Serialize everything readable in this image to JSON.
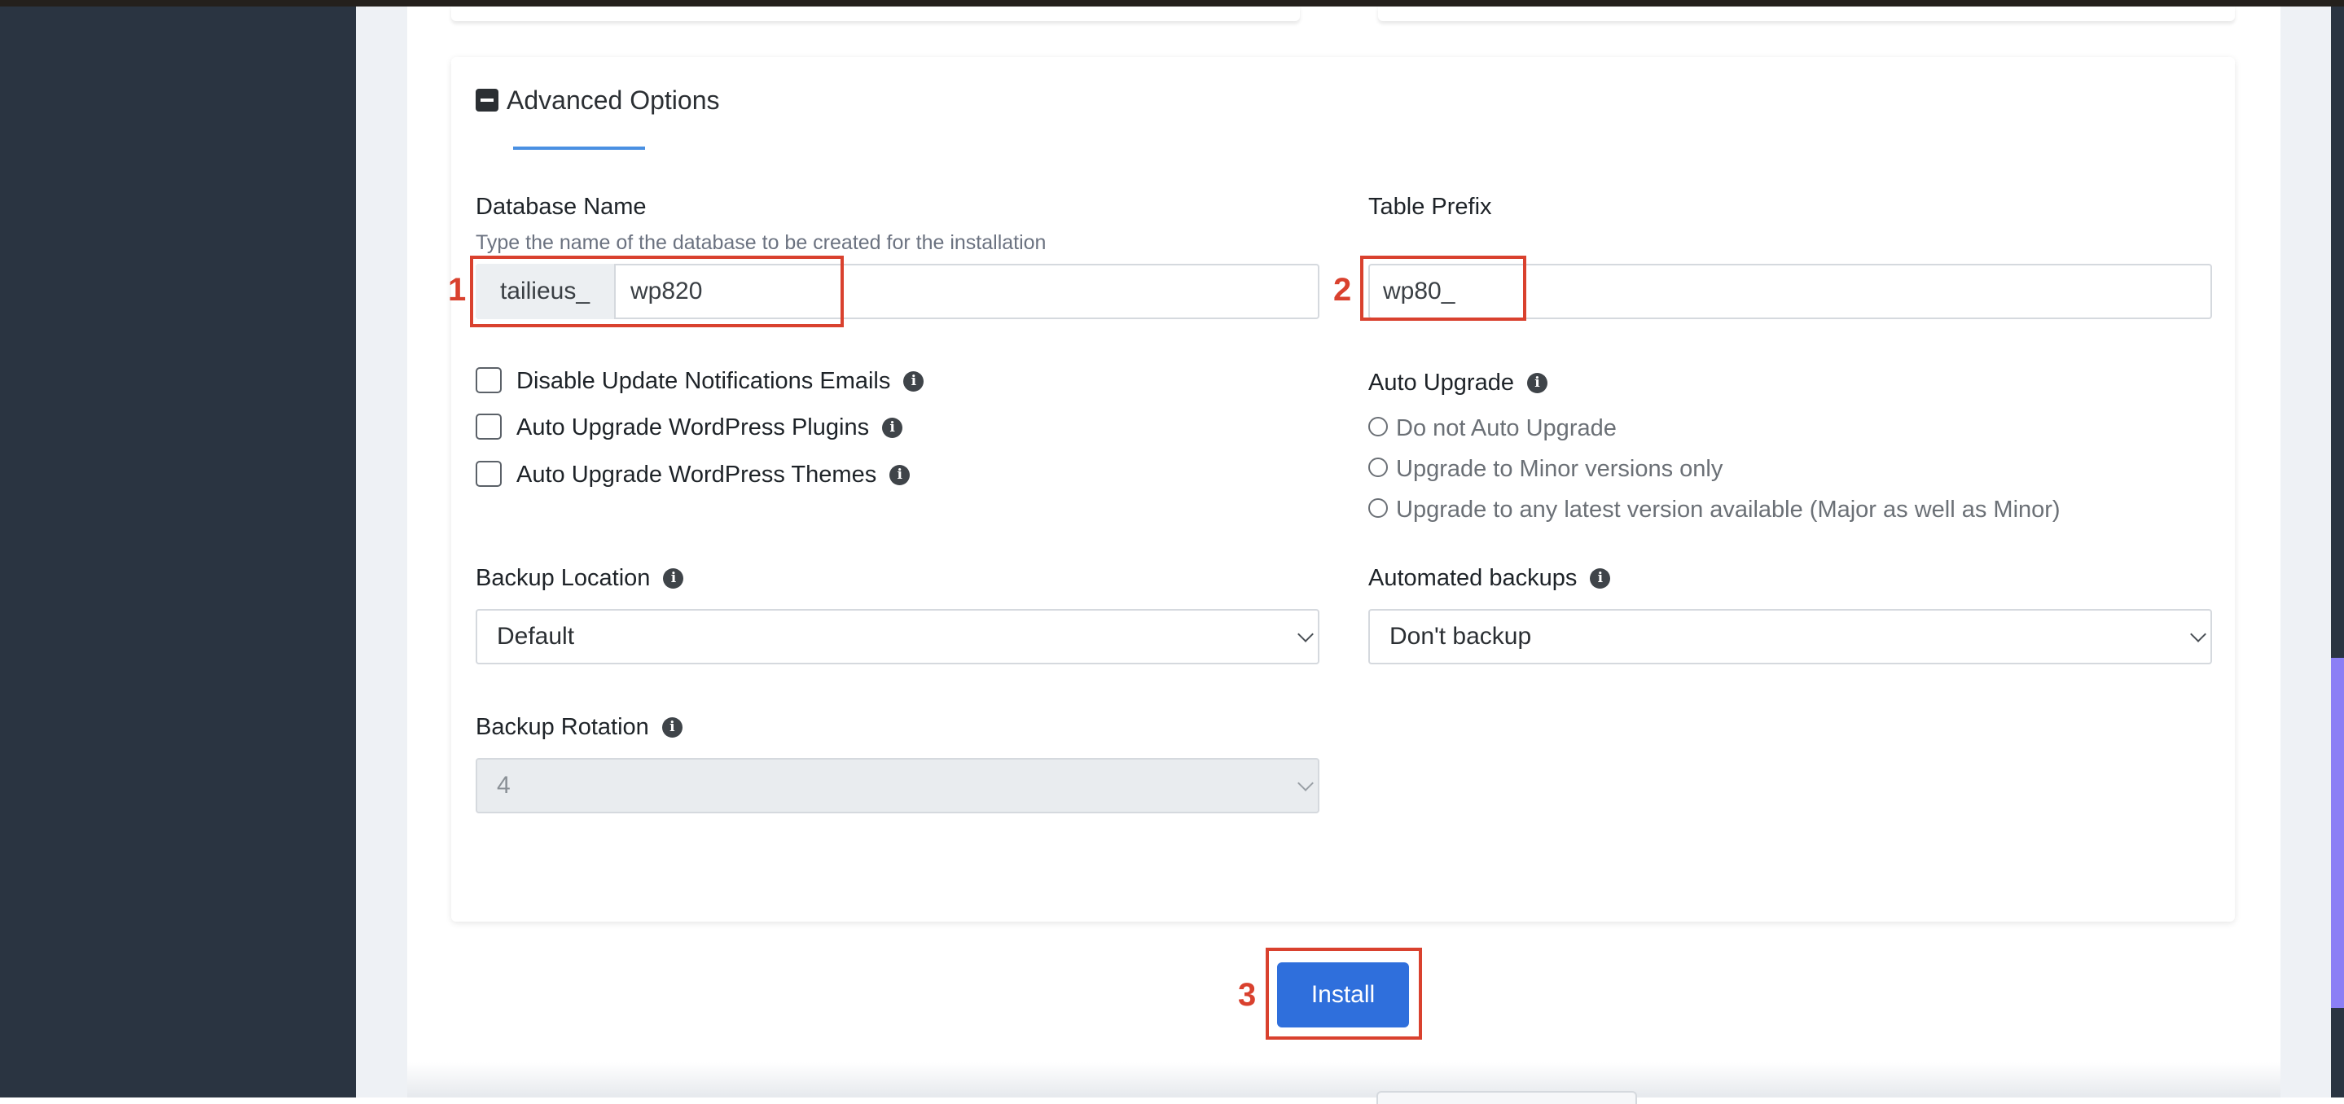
{
  "advanced_options": {
    "title": "Advanced Options",
    "database_name": {
      "label": "Database Name",
      "help": "Type the name of the database to be created for the installation",
      "prefix": "tailieus_",
      "value": "wp820"
    },
    "table_prefix": {
      "label": "Table Prefix",
      "value": "wp80_"
    },
    "checkboxes": [
      {
        "label": "Disable Update Notifications Emails",
        "checked": false
      },
      {
        "label": "Auto Upgrade WordPress Plugins",
        "checked": false
      },
      {
        "label": "Auto Upgrade WordPress Themes",
        "checked": false
      }
    ],
    "auto_upgrade": {
      "label": "Auto Upgrade",
      "options": [
        "Do not Auto Upgrade",
        "Upgrade to Minor versions only",
        "Upgrade to any latest version available (Major as well as Minor)"
      ]
    },
    "backup_location": {
      "label": "Backup Location",
      "selected": "Default"
    },
    "automated_backups": {
      "label": "Automated backups",
      "selected": "Don't backup"
    },
    "backup_rotation": {
      "label": "Backup Rotation",
      "selected": "4"
    }
  },
  "install_button": {
    "label": "Install"
  },
  "annotations": [
    "1",
    "2",
    "3"
  ],
  "icons": {
    "info": "info-icon",
    "collapse": "minus-square-icon",
    "select": "chevron-down-icon"
  },
  "colors": {
    "sidebar": "#2a3441",
    "primary_button": "#2f6fdc",
    "annotation": "#d9412e",
    "tab_underline": "#4a90e2"
  }
}
